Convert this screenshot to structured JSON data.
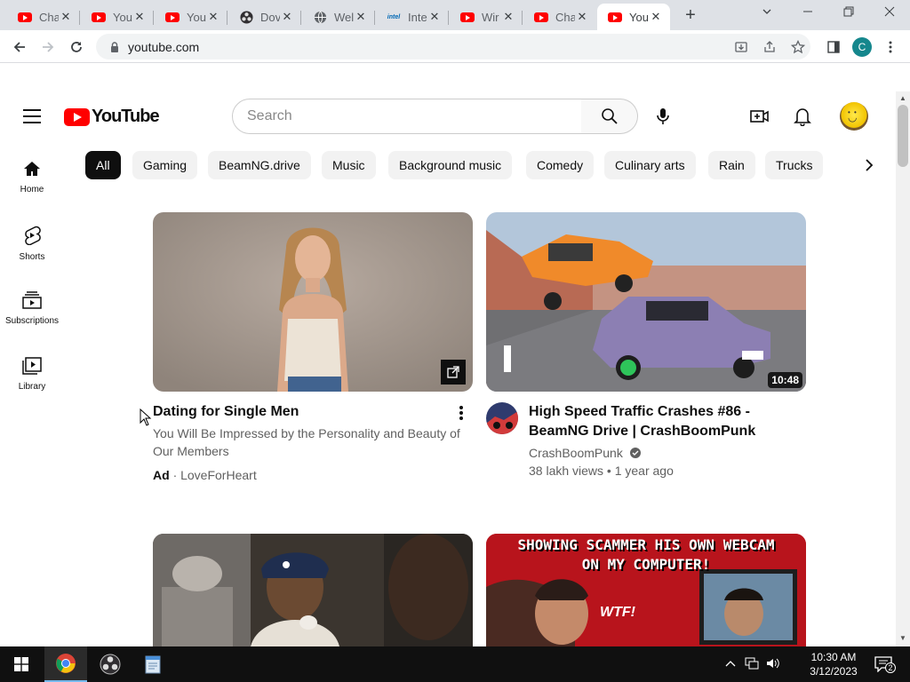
{
  "browser": {
    "tabs": [
      {
        "title": "Cha",
        "icon": "youtube-icon",
        "active": false
      },
      {
        "title": "You",
        "icon": "youtube-icon",
        "active": false
      },
      {
        "title": "You",
        "icon": "youtube-icon",
        "active": false
      },
      {
        "title": "Dov",
        "icon": "obs-icon",
        "active": false
      },
      {
        "title": "Wel",
        "icon": "globe-icon",
        "active": false
      },
      {
        "title": "Inte",
        "icon": "intel-icon",
        "active": false
      },
      {
        "title": "Wir",
        "icon": "youtube-icon",
        "active": false
      },
      {
        "title": "Cha",
        "icon": "youtube-icon",
        "active": false
      },
      {
        "title": "You",
        "icon": "youtube-icon",
        "active": true
      }
    ],
    "url": "youtube.com",
    "profile_initial": "C",
    "intel_label": "intel"
  },
  "youtube": {
    "logo_text": "YouTube",
    "search_placeholder": "Search",
    "sidebar": [
      {
        "label": "Home",
        "icon": "home-icon"
      },
      {
        "label": "Shorts",
        "icon": "shorts-icon"
      },
      {
        "label": "Subscriptions",
        "icon": "subscriptions-icon"
      },
      {
        "label": "Library",
        "icon": "library-icon"
      }
    ],
    "chips": [
      "All",
      "Gaming",
      "BeamNG.drive",
      "Music",
      "Background music",
      "Comedy",
      "Culinary arts",
      "Rain",
      "Trucks"
    ],
    "videos": [
      {
        "title": "Dating for Single Men",
        "description": "You Will Be Impressed by the Personality and Beauty of Our Members",
        "ad_label": "Ad",
        "advertiser": "· LoveForHeart"
      },
      {
        "title_line1": "High Speed Traffic Crashes #86 -",
        "title_line2": "BeamNG Drive | CrashBoomPunk",
        "channel": "CrashBoomPunk",
        "stats": "38 lakh views • 1 year ago",
        "duration": "10:48"
      },
      {
        "title": ""
      },
      {
        "thumb_line1": "SHOWING SCAMMER HIS OWN WEBCAM",
        "thumb_line2": "ON MY COMPUTER!",
        "thumb_tag": "WTF!"
      }
    ]
  },
  "taskbar": {
    "time": "10:30 AM",
    "date": "3/12/2023",
    "notification_count": "2"
  },
  "colors": {
    "tab_strip": "#dee1e6",
    "youtube_red": "#ff0000",
    "taskbar": "#101010"
  }
}
